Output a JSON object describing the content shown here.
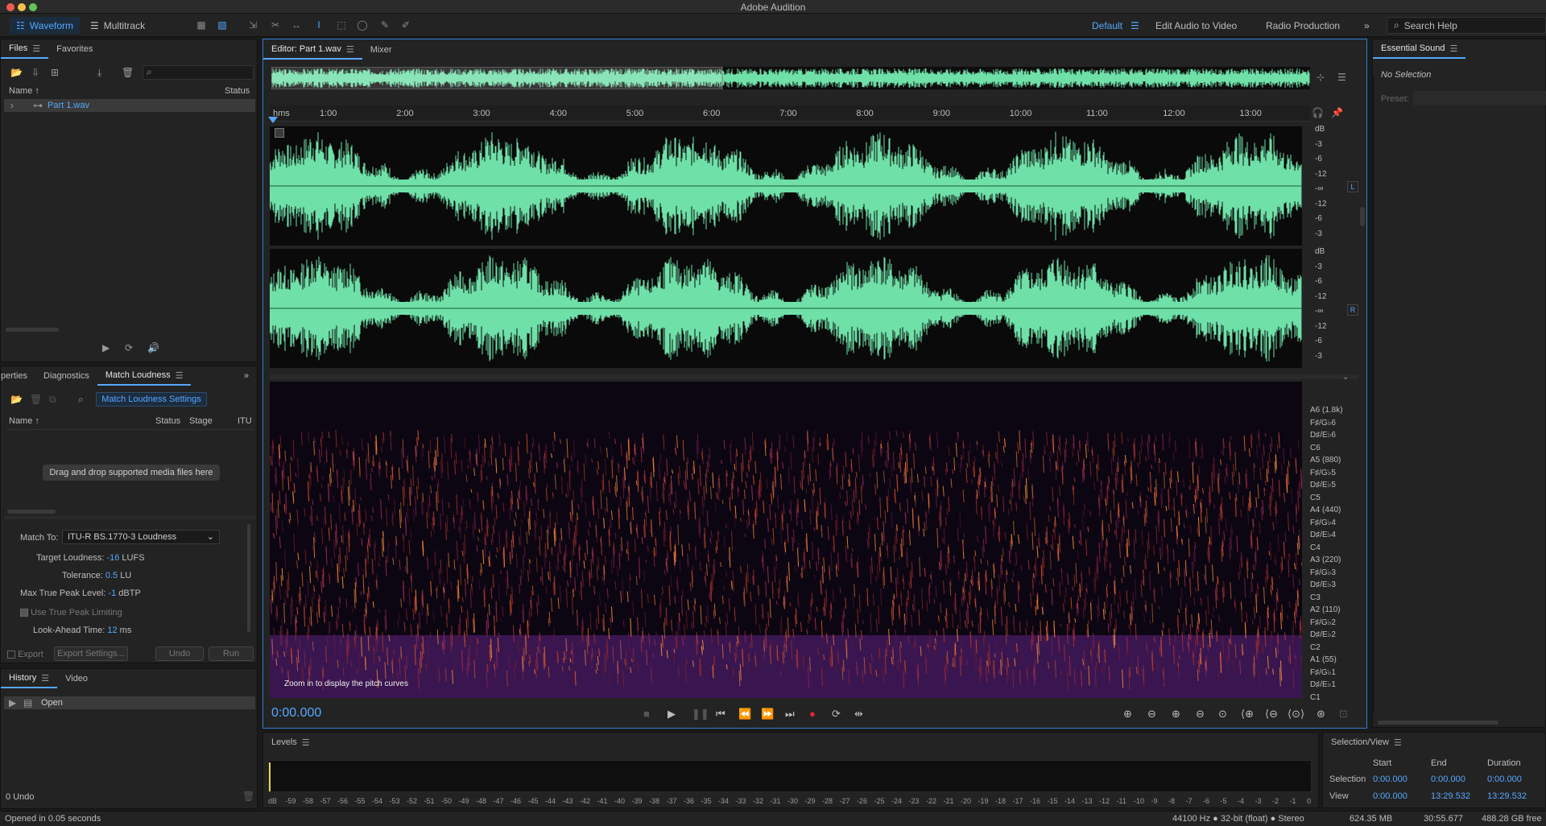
{
  "app": {
    "title": "Adobe Audition"
  },
  "modes": {
    "waveform": "Waveform",
    "multitrack": "Multitrack"
  },
  "workspaces": {
    "default": "Default",
    "edit_audio_to_video": "Edit Audio to Video",
    "radio_production": "Radio Production"
  },
  "search": {
    "placeholder": "Search Help"
  },
  "files_panel": {
    "tab_files": "Files",
    "tab_favorites": "Favorites",
    "col_name": "Name",
    "col_status": "Status",
    "file_name": "Part 1.wav"
  },
  "match_panel": {
    "tab_properties": "perties",
    "tab_diagnostics": "Diagnostics",
    "tab_match": "Match Loudness",
    "settings_button": "Match Loudness Settings",
    "col_name": "Name",
    "col_status": "Status",
    "col_stage": "Stage",
    "col_itu": "ITU",
    "drop_hint": "Drag and drop supported media files here",
    "match_to_label": "Match To:",
    "match_to_value": "ITU-R BS.1770-3 Loudness",
    "target_label": "Target Loudness:",
    "target_value": "-16",
    "target_unit": "LUFS",
    "tolerance_label": "Tolerance:",
    "tolerance_value": "0.5",
    "tolerance_unit": "LU",
    "max_peak_label": "Max True Peak Level:",
    "max_peak_value": "-1",
    "max_peak_unit": "dBTP",
    "use_true_peak_label": "Use True Peak Limiting",
    "lookahead_label": "Look-Ahead Time:",
    "lookahead_value": "12",
    "lookahead_unit": "ms",
    "export_label": "Export",
    "export_settings": "Export Settings...",
    "undo": "Undo",
    "run": "Run"
  },
  "history_panel": {
    "tab_history": "History",
    "tab_video": "Video",
    "item_open": "Open",
    "undo_count": "0 Undo"
  },
  "editor": {
    "tab_editor": "Editor: Part 1.wav",
    "tab_mixer": "Mixer",
    "ruler_unit": "hms",
    "ruler_ticks": [
      "1:00",
      "2:00",
      "3:00",
      "4:00",
      "5:00",
      "6:00",
      "7:00",
      "8:00",
      "9:00",
      "10:00",
      "11:00",
      "12:00",
      "13:00"
    ],
    "db_scale": [
      "dB",
      "-3",
      "-6",
      "-12",
      "-∞",
      "-12",
      "-6",
      "-3"
    ],
    "channel_left": "L",
    "channel_right": "R",
    "pitch_labels": [
      "A6 (1.8k)",
      "F♯/G♭6",
      "D♯/E♭6",
      "C6",
      "A5 (880)",
      "F♯/G♭5",
      "D♯/E♭5",
      "C5",
      "A4 (440)",
      "F♯/G♭4",
      "D♯/E♭4",
      "C4",
      "A3 (220)",
      "F♯/G♭3",
      "D♯/E♭3",
      "C3",
      "A2 (110)",
      "F♯/G♭2",
      "D♯/E♭2",
      "C2",
      "A1 (55)",
      "F♯/G♭1",
      "D♯/E♭1",
      "C1"
    ],
    "pitch_hint": "Zoom in to display the pitch curves",
    "time_display": "0:00.000"
  },
  "essential_sound": {
    "title": "Essential Sound",
    "no_selection": "No Selection",
    "preset_label": "Preset:"
  },
  "levels": {
    "title": "Levels",
    "scale": [
      "dB",
      "-59",
      "-58",
      "-57",
      "-56",
      "-55",
      "-54",
      "-53",
      "-52",
      "-51",
      "-50",
      "-49",
      "-48",
      "-47",
      "-46",
      "-45",
      "-44",
      "-43",
      "-42",
      "-41",
      "-40",
      "-39",
      "-38",
      "-37",
      "-36",
      "-35",
      "-34",
      "-33",
      "-32",
      "-31",
      "-30",
      "-29",
      "-28",
      "-27",
      "-26",
      "-25",
      "-24",
      "-23",
      "-22",
      "-21",
      "-20",
      "-19",
      "-18",
      "-17",
      "-16",
      "-15",
      "-14",
      "-13",
      "-12",
      "-11",
      "-10",
      "-9",
      "-8",
      "-7",
      "-6",
      "-5",
      "-4",
      "-3",
      "-2",
      "-1",
      "0"
    ]
  },
  "selection_view": {
    "title": "Selection/View",
    "col_start": "Start",
    "col_end": "End",
    "col_duration": "Duration",
    "row_selection": "Selection",
    "row_view": "View",
    "sel_start": "0:00.000",
    "sel_end": "0:00.000",
    "sel_duration": "0:00.000",
    "view_start": "0:00.000",
    "view_end": "13:29.532",
    "view_duration": "13:29.532"
  },
  "status": {
    "opened": "Opened in 0.05 seconds",
    "format": "44100 Hz ● 32-bit (float) ● Stereo",
    "size": "624.35 MB",
    "duration": "30:55.677",
    "free": "488.28 GB free"
  },
  "colors": {
    "accent": "#56a8ff",
    "waveform": "#6fe0a8",
    "record": "#e0282d"
  }
}
